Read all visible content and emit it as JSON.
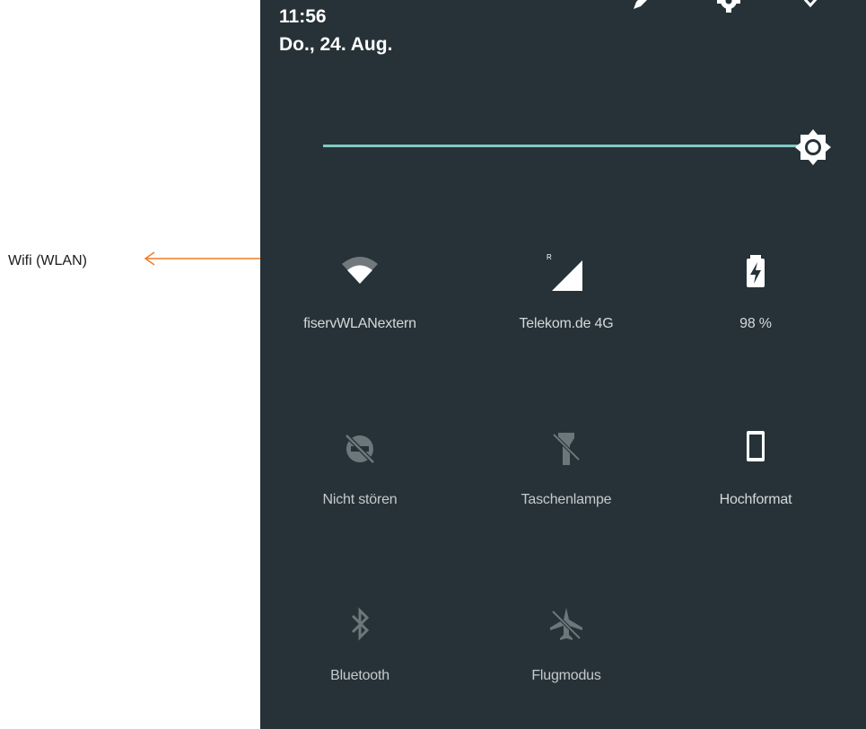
{
  "annotation": {
    "label": "Wifi (WLAN)",
    "color": "#f07c22"
  },
  "status": {
    "time": "11:56",
    "date": "Do., 24. Aug."
  },
  "header_icons": [
    "edit-icon",
    "settings-icon",
    "expand-icon"
  ],
  "brightness": {
    "level": 1.0,
    "icon": "brightness-icon",
    "track_color": "#80cbc4"
  },
  "tiles": [
    {
      "label": "fiservWLANextern",
      "icon": "wifi-icon",
      "active": true
    },
    {
      "label": "Telekom.de 4G",
      "icon": "cellular-signal-icon",
      "active": true
    },
    {
      "label": "98 %",
      "icon": "battery-charging-icon",
      "active": true
    },
    {
      "label": "Nicht stören",
      "icon": "do-not-disturb-icon",
      "active": false
    },
    {
      "label": "Taschenlampe",
      "icon": "flashlight-icon",
      "active": false
    },
    {
      "label": "Hochformat",
      "icon": "portrait-rotation-icon",
      "active": true
    },
    {
      "label": "Bluetooth",
      "icon": "bluetooth-icon",
      "active": false
    },
    {
      "label": "Flugmodus",
      "icon": "airplane-mode-icon",
      "active": false
    }
  ],
  "colors": {
    "panel": "#263238",
    "active_icon": "#ffffff",
    "inactive_icon": "#6c777c"
  }
}
